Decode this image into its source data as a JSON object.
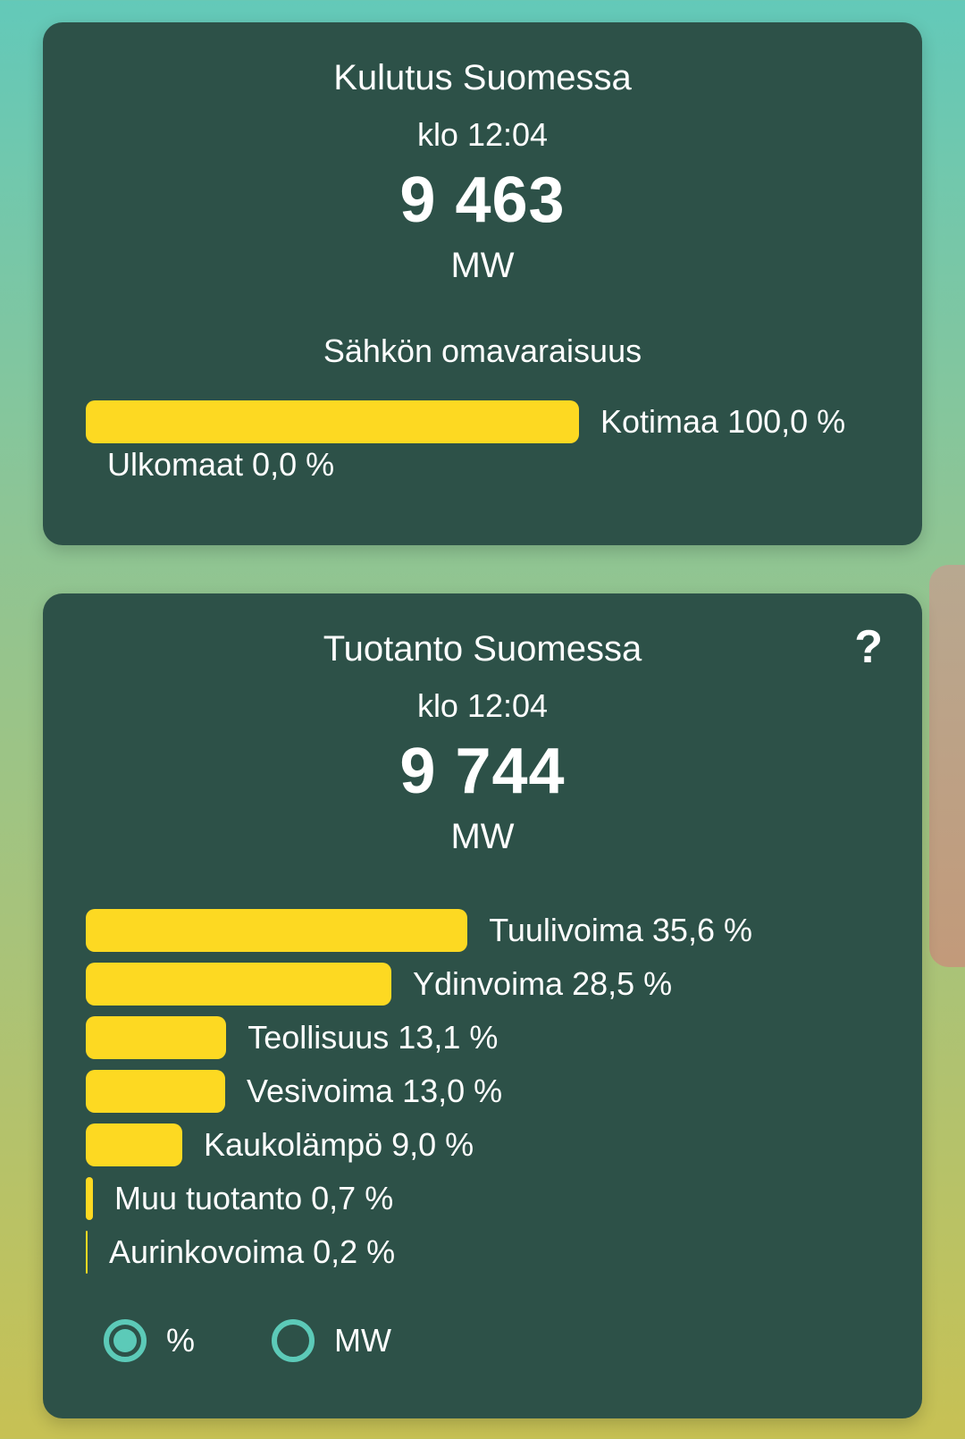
{
  "consumption": {
    "title": "Kulutus Suomessa",
    "time": "klo 12:04",
    "value": "9 463",
    "unit": "MW",
    "self_sufficiency": {
      "title": "Sähkön omavaraisuus",
      "domestic": {
        "label": "Kotimaa 100,0 %",
        "percent": 100.0
      },
      "foreign": {
        "label": "Ulkomaat 0,0 %",
        "percent": 0.0
      }
    }
  },
  "production": {
    "title": "Tuotanto Suomessa",
    "help_label": "?",
    "time": "klo 12:04",
    "value": "9 744",
    "unit": "MW",
    "sources": [
      {
        "label": "Tuulivoima 35,6 %",
        "percent": 35.6
      },
      {
        "label": "Ydinvoima 28,5 %",
        "percent": 28.5
      },
      {
        "label": "Teollisuus 13,1 %",
        "percent": 13.1
      },
      {
        "label": "Vesivoima 13,0 %",
        "percent": 13.0
      },
      {
        "label": "Kaukolämpö 9,0 %",
        "percent": 9.0
      },
      {
        "label": "Muu tuotanto 0,7 %",
        "percent": 0.7
      },
      {
        "label": "Aurinkovoima 0,2 %",
        "percent": 0.2
      }
    ],
    "unit_toggle": {
      "options": [
        "%",
        "MW"
      ],
      "selected": "%"
    }
  },
  "colors": {
    "card": "#2d5148",
    "bar": "#fdd922",
    "accent": "#5ccab8"
  }
}
